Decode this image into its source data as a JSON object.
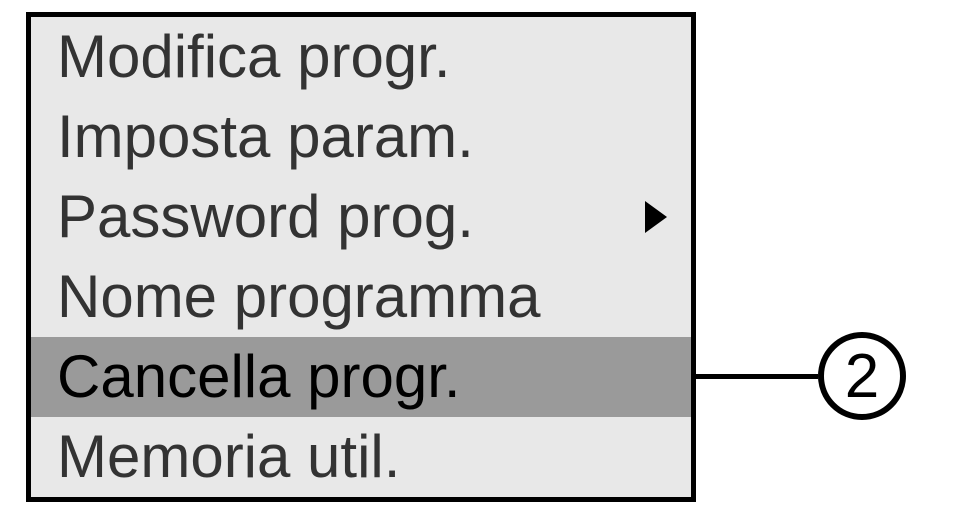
{
  "menu": {
    "items": [
      {
        "label": "Modifica progr.",
        "highlighted": false,
        "has_submenu": false
      },
      {
        "label": "Imposta param.",
        "highlighted": false,
        "has_submenu": false
      },
      {
        "label": "Password prog.",
        "highlighted": false,
        "has_submenu": true
      },
      {
        "label": "Nome programma",
        "highlighted": false,
        "has_submenu": false
      },
      {
        "label": "Cancella progr.",
        "highlighted": true,
        "has_submenu": false
      },
      {
        "label": "Memoria util.",
        "highlighted": false,
        "has_submenu": false
      }
    ]
  },
  "callout": {
    "number": "2"
  }
}
